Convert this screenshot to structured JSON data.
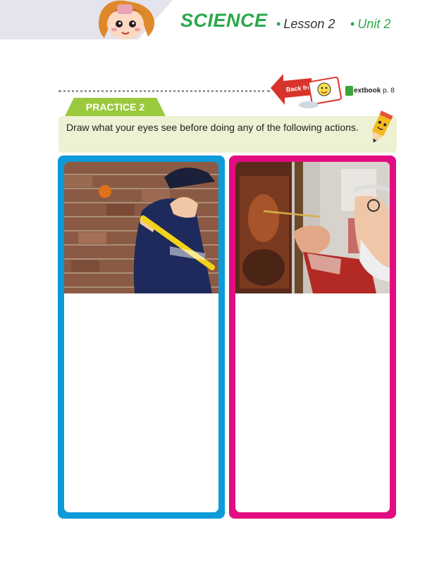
{
  "header": {
    "subject": "SCIENCE",
    "lesson": "Lesson 2",
    "unit": "Unit 2",
    "mascot_icon": "girl-mascot-icon"
  },
  "reference": {
    "back_arrow_text": "Back from",
    "textbook_label": "extbook",
    "page": "p. 8"
  },
  "practice": {
    "label": "PRACTICE 2",
    "instruction": "Draw what your eyes see before doing any of the following actions."
  },
  "panels": [
    {
      "image_subject": "baseball-batter-photo",
      "border_color": "#0c9ad8"
    },
    {
      "image_subject": "painter-at-canvas-photo",
      "border_color": "#e20d80"
    }
  ],
  "colors": {
    "brand_green": "#2aa84a",
    "tab_green": "#9bc93e",
    "instruction_bg": "#eef1d3",
    "panel_blue": "#0c9ad8",
    "panel_pink": "#e20d80"
  }
}
